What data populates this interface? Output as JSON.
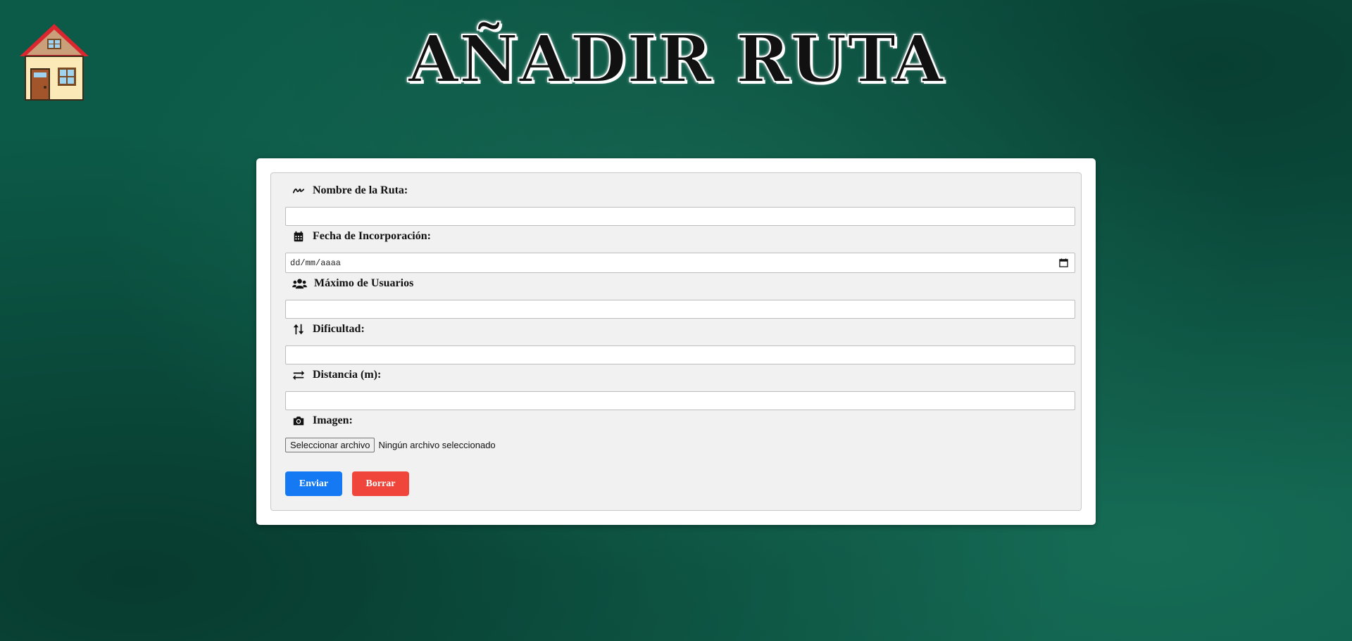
{
  "header": {
    "title": "AÑADIR RUTA",
    "home_icon": "house-emoji-icon"
  },
  "form": {
    "fields": {
      "nombre": {
        "label": "Nombre de la Ruta:",
        "icon": "signature-icon",
        "value": "",
        "placeholder": ""
      },
      "fecha": {
        "label": "Fecha de Incorporación:",
        "icon": "calendar-icon",
        "display": "dd/mm/aaaa"
      },
      "maximo": {
        "label": "Máximo de Usuarios",
        "icon": "users-icon",
        "value": "",
        "placeholder": ""
      },
      "dificultad": {
        "label": "Dificultad:",
        "icon": "sort-arrows-icon",
        "value": "",
        "placeholder": ""
      },
      "distancia": {
        "label": "Distancia (m):",
        "icon": "exchange-arrows-icon",
        "value": "",
        "placeholder": ""
      },
      "imagen": {
        "label": "Imagen:",
        "icon": "camera-icon",
        "button_label": "Seleccionar archivo",
        "status": "Ningún archivo seleccionado"
      }
    },
    "buttons": {
      "submit": "Enviar",
      "reset": "Borrar"
    }
  },
  "colors": {
    "background": "#0c5a48",
    "submit": "#1479f2",
    "reset": "#f0453a"
  }
}
